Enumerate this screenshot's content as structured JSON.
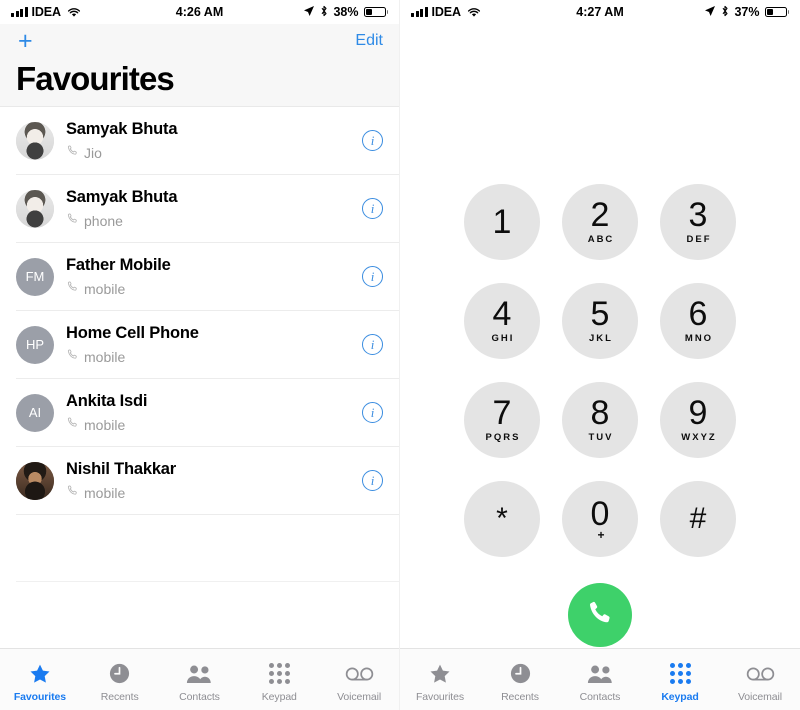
{
  "left": {
    "status_bar": {
      "carrier": "IDEA",
      "time": "4:26 AM",
      "battery_percent": "38%",
      "battery_level": 38,
      "icons": [
        "signal-icon",
        "wifi-icon",
        "location-arrow-icon",
        "bluetooth-icon",
        "battery-icon"
      ]
    },
    "nav": {
      "add_label": "+",
      "edit_label": "Edit",
      "title": "Favourites"
    },
    "favourites": [
      {
        "name": "Samyak Bhuta",
        "label": "Jio",
        "avatar_type": "photo-a",
        "initials": ""
      },
      {
        "name": "Samyak Bhuta",
        "label": "phone",
        "avatar_type": "photo-a",
        "initials": ""
      },
      {
        "name": "Father Mobile",
        "label": "mobile",
        "avatar_type": "initials",
        "initials": "FM"
      },
      {
        "name": "Home Cell Phone",
        "label": "mobile",
        "avatar_type": "initials",
        "initials": "HP"
      },
      {
        "name": "Ankita Isdi",
        "label": "mobile",
        "avatar_type": "initials",
        "initials": "AI"
      },
      {
        "name": "Nishil Thakkar",
        "label": "mobile",
        "avatar_type": "photo-b",
        "initials": ""
      }
    ],
    "info_button_glyph": "i",
    "tabs": [
      {
        "label": "Favourites",
        "icon": "star-icon",
        "active": true
      },
      {
        "label": "Recents",
        "icon": "clock-icon",
        "active": false
      },
      {
        "label": "Contacts",
        "icon": "contacts-icon",
        "active": false
      },
      {
        "label": "Keypad",
        "icon": "keypad-icon",
        "active": false
      },
      {
        "label": "Voicemail",
        "icon": "voicemail-icon",
        "active": false
      }
    ]
  },
  "right": {
    "status_bar": {
      "carrier": "IDEA",
      "time": "4:27 AM",
      "battery_percent": "37%",
      "battery_level": 37,
      "icons": [
        "signal-icon",
        "wifi-icon",
        "location-arrow-icon",
        "bluetooth-icon",
        "battery-icon"
      ]
    },
    "keypad": [
      {
        "digit": "1",
        "letters": ""
      },
      {
        "digit": "2",
        "letters": "ABC"
      },
      {
        "digit": "3",
        "letters": "DEF"
      },
      {
        "digit": "4",
        "letters": "GHI"
      },
      {
        "digit": "5",
        "letters": "JKL"
      },
      {
        "digit": "6",
        "letters": "MNO"
      },
      {
        "digit": "7",
        "letters": "PQRS"
      },
      {
        "digit": "8",
        "letters": "TUV"
      },
      {
        "digit": "9",
        "letters": "WXYZ"
      },
      {
        "digit": "*",
        "letters": ""
      },
      {
        "digit": "0",
        "letters": "+"
      },
      {
        "digit": "#",
        "letters": ""
      }
    ],
    "call_button": {
      "icon": "phone-handset-icon",
      "color": "#3ed16a"
    },
    "tabs": [
      {
        "label": "Favourites",
        "icon": "star-icon",
        "active": false
      },
      {
        "label": "Recents",
        "icon": "clock-icon",
        "active": false
      },
      {
        "label": "Contacts",
        "icon": "contacts-icon",
        "active": false
      },
      {
        "label": "Keypad",
        "icon": "keypad-icon",
        "active": true
      },
      {
        "label": "Voicemail",
        "icon": "voicemail-icon",
        "active": false
      }
    ]
  },
  "colors": {
    "accent_blue": "#1a7bf0",
    "link_blue": "#2e8ae6",
    "info_blue": "#3b8de0",
    "call_green": "#3ed16a",
    "inactive_gray": "#8e8e93",
    "key_gray": "#e4e4e4",
    "header_gray": "#f7f7f7"
  }
}
